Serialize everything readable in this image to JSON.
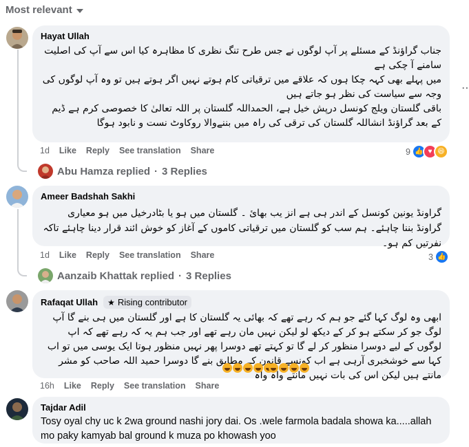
{
  "sort": {
    "label": "Most relevant"
  },
  "comments": [
    {
      "author": "Hayat Ullah",
      "lines": [
        "جناب گراؤنڈ کے مسئلے پر آپ لوگوں نے جس طرح تنگ نظری کا مظاہرہ کیا اس سے آپ کی اصلیت سامنے آ چکی ہے",
        "میں پہلے بھی کہہ چکا ہوں کہ علاقے میں ترقیاتی کام ہوتے نہیں اگر ہوتے ہیں تو وہ آپ لوگوں کی وجہ سے سیاست کی نظر ہو جاتے ہیں",
        "باقی گلستان ویلج کونسل درپش خیل ہے، الحمداللہ گلستان پر اللہ تعالیٰ کا خصوصی کرم ہے ڈیم کے بعد گراؤنڈ انشاللہ گلستان کی ترقی کی راہ میں بننےوالا روکاوٹ نست و نابود ہوگا"
      ],
      "time": "1d",
      "like": "Like",
      "reply": "Reply",
      "see_translation": "See translation",
      "share": "Share",
      "reaction_count": "9",
      "replies_by": "Abu Hamza replied",
      "replies_count": "3 Replies"
    },
    {
      "author": "Ameer Badshah Sakhi",
      "lines": [
        "گراونڈ یونین کونسل کے اندر ہی ہے انز یب بھائ ۔ گلستان میں ہو یا بٹادرخیل میں ہو معیاری گراونڈ بننا چاہئے۔ ہم سب کو گلستان میں ترقیاتی کاموں کے آغاز کو خوش ائند قرار دینا چاہئے تاکہ نفرتیں کم ہو۔"
      ],
      "time": "1d",
      "like": "Like",
      "reply": "Reply",
      "see_translation": "See translation",
      "share": "Share",
      "reaction_count": "3",
      "replies_by": "Aanzaib Khattak replied",
      "replies_count": "3 Replies"
    },
    {
      "author": "Rafaqat Ullah",
      "badge": "Rising contributor",
      "lines": [
        "ابھی وہ لوگ کہا گئے جو ہم کہ رہے تھے کہ بھائی یہ گلستان کا ہے اور گلستان میں ہی بنے گا آپ لوگ جو کر سکتے ہو کر کے دیکھ لو لیکن نہیں مان رہے تھے اور جب ہم یہ کہ رہے تھے کہ اپ لوگوں کے لیے دوسرا منظور کر لے گا تو کہتے تھے دوسرا پھر نہیں منظور ہوتا ایک یوسی میں تو اب کہا سے خوشخبری آرہی ہے اب کونسے قانون کے مطابق بنے گا دوسرا حمید اللہ صاحب کو مشر مانتے ہیں لیکن اس کی بات نہیں مانتے واہ واہ"
      ],
      "time": "16h",
      "like": "Like",
      "reply": "Reply",
      "see_translation": "See translation",
      "share": "Share"
    },
    {
      "author": "Tajdar Adil",
      "text": "Tosy oyal chy uc k 2wa ground nashi jory dai. Os .wele farmola badala showa ka.....allah mo paky kamyab bal ground k muza po khowash yoo"
    }
  ],
  "colors": {
    "bubble": "#f0f2f5",
    "meta": "#65676b",
    "like": "#1877f2",
    "love": "#f33e58",
    "haha": "#f7b125"
  }
}
